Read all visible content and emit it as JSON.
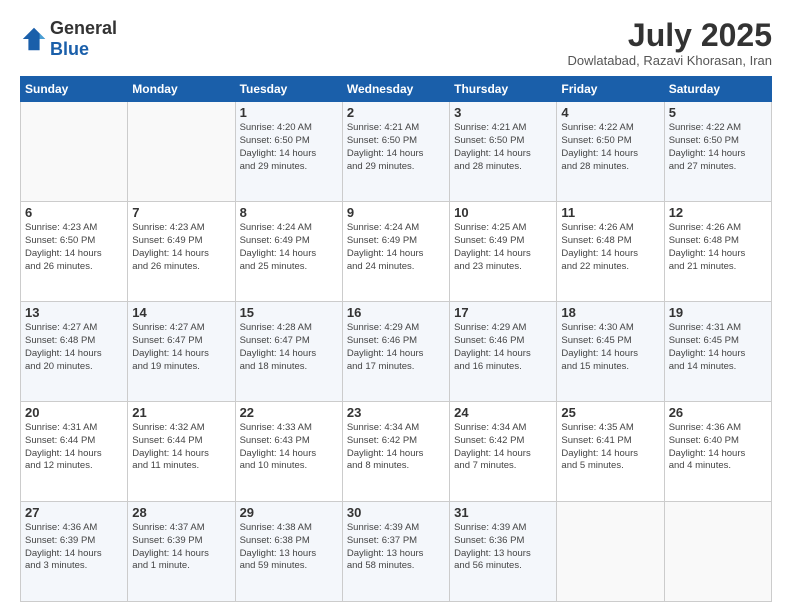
{
  "header": {
    "logo_general": "General",
    "logo_blue": "Blue",
    "month_title": "July 2025",
    "location": "Dowlatabad, Razavi Khorasan, Iran"
  },
  "days_of_week": [
    "Sunday",
    "Monday",
    "Tuesday",
    "Wednesday",
    "Thursday",
    "Friday",
    "Saturday"
  ],
  "weeks": [
    [
      {
        "day": "",
        "info": ""
      },
      {
        "day": "",
        "info": ""
      },
      {
        "day": "1",
        "info": "Sunrise: 4:20 AM\nSunset: 6:50 PM\nDaylight: 14 hours\nand 29 minutes."
      },
      {
        "day": "2",
        "info": "Sunrise: 4:21 AM\nSunset: 6:50 PM\nDaylight: 14 hours\nand 29 minutes."
      },
      {
        "day": "3",
        "info": "Sunrise: 4:21 AM\nSunset: 6:50 PM\nDaylight: 14 hours\nand 28 minutes."
      },
      {
        "day": "4",
        "info": "Sunrise: 4:22 AM\nSunset: 6:50 PM\nDaylight: 14 hours\nand 28 minutes."
      },
      {
        "day": "5",
        "info": "Sunrise: 4:22 AM\nSunset: 6:50 PM\nDaylight: 14 hours\nand 27 minutes."
      }
    ],
    [
      {
        "day": "6",
        "info": "Sunrise: 4:23 AM\nSunset: 6:50 PM\nDaylight: 14 hours\nand 26 minutes."
      },
      {
        "day": "7",
        "info": "Sunrise: 4:23 AM\nSunset: 6:49 PM\nDaylight: 14 hours\nand 26 minutes."
      },
      {
        "day": "8",
        "info": "Sunrise: 4:24 AM\nSunset: 6:49 PM\nDaylight: 14 hours\nand 25 minutes."
      },
      {
        "day": "9",
        "info": "Sunrise: 4:24 AM\nSunset: 6:49 PM\nDaylight: 14 hours\nand 24 minutes."
      },
      {
        "day": "10",
        "info": "Sunrise: 4:25 AM\nSunset: 6:49 PM\nDaylight: 14 hours\nand 23 minutes."
      },
      {
        "day": "11",
        "info": "Sunrise: 4:26 AM\nSunset: 6:48 PM\nDaylight: 14 hours\nand 22 minutes."
      },
      {
        "day": "12",
        "info": "Sunrise: 4:26 AM\nSunset: 6:48 PM\nDaylight: 14 hours\nand 21 minutes."
      }
    ],
    [
      {
        "day": "13",
        "info": "Sunrise: 4:27 AM\nSunset: 6:48 PM\nDaylight: 14 hours\nand 20 minutes."
      },
      {
        "day": "14",
        "info": "Sunrise: 4:27 AM\nSunset: 6:47 PM\nDaylight: 14 hours\nand 19 minutes."
      },
      {
        "day": "15",
        "info": "Sunrise: 4:28 AM\nSunset: 6:47 PM\nDaylight: 14 hours\nand 18 minutes."
      },
      {
        "day": "16",
        "info": "Sunrise: 4:29 AM\nSunset: 6:46 PM\nDaylight: 14 hours\nand 17 minutes."
      },
      {
        "day": "17",
        "info": "Sunrise: 4:29 AM\nSunset: 6:46 PM\nDaylight: 14 hours\nand 16 minutes."
      },
      {
        "day": "18",
        "info": "Sunrise: 4:30 AM\nSunset: 6:45 PM\nDaylight: 14 hours\nand 15 minutes."
      },
      {
        "day": "19",
        "info": "Sunrise: 4:31 AM\nSunset: 6:45 PM\nDaylight: 14 hours\nand 14 minutes."
      }
    ],
    [
      {
        "day": "20",
        "info": "Sunrise: 4:31 AM\nSunset: 6:44 PM\nDaylight: 14 hours\nand 12 minutes."
      },
      {
        "day": "21",
        "info": "Sunrise: 4:32 AM\nSunset: 6:44 PM\nDaylight: 14 hours\nand 11 minutes."
      },
      {
        "day": "22",
        "info": "Sunrise: 4:33 AM\nSunset: 6:43 PM\nDaylight: 14 hours\nand 10 minutes."
      },
      {
        "day": "23",
        "info": "Sunrise: 4:34 AM\nSunset: 6:42 PM\nDaylight: 14 hours\nand 8 minutes."
      },
      {
        "day": "24",
        "info": "Sunrise: 4:34 AM\nSunset: 6:42 PM\nDaylight: 14 hours\nand 7 minutes."
      },
      {
        "day": "25",
        "info": "Sunrise: 4:35 AM\nSunset: 6:41 PM\nDaylight: 14 hours\nand 5 minutes."
      },
      {
        "day": "26",
        "info": "Sunrise: 4:36 AM\nSunset: 6:40 PM\nDaylight: 14 hours\nand 4 minutes."
      }
    ],
    [
      {
        "day": "27",
        "info": "Sunrise: 4:36 AM\nSunset: 6:39 PM\nDaylight: 14 hours\nand 3 minutes."
      },
      {
        "day": "28",
        "info": "Sunrise: 4:37 AM\nSunset: 6:39 PM\nDaylight: 14 hours\nand 1 minute."
      },
      {
        "day": "29",
        "info": "Sunrise: 4:38 AM\nSunset: 6:38 PM\nDaylight: 13 hours\nand 59 minutes."
      },
      {
        "day": "30",
        "info": "Sunrise: 4:39 AM\nSunset: 6:37 PM\nDaylight: 13 hours\nand 58 minutes."
      },
      {
        "day": "31",
        "info": "Sunrise: 4:39 AM\nSunset: 6:36 PM\nDaylight: 13 hours\nand 56 minutes."
      },
      {
        "day": "",
        "info": ""
      },
      {
        "day": "",
        "info": ""
      }
    ]
  ]
}
